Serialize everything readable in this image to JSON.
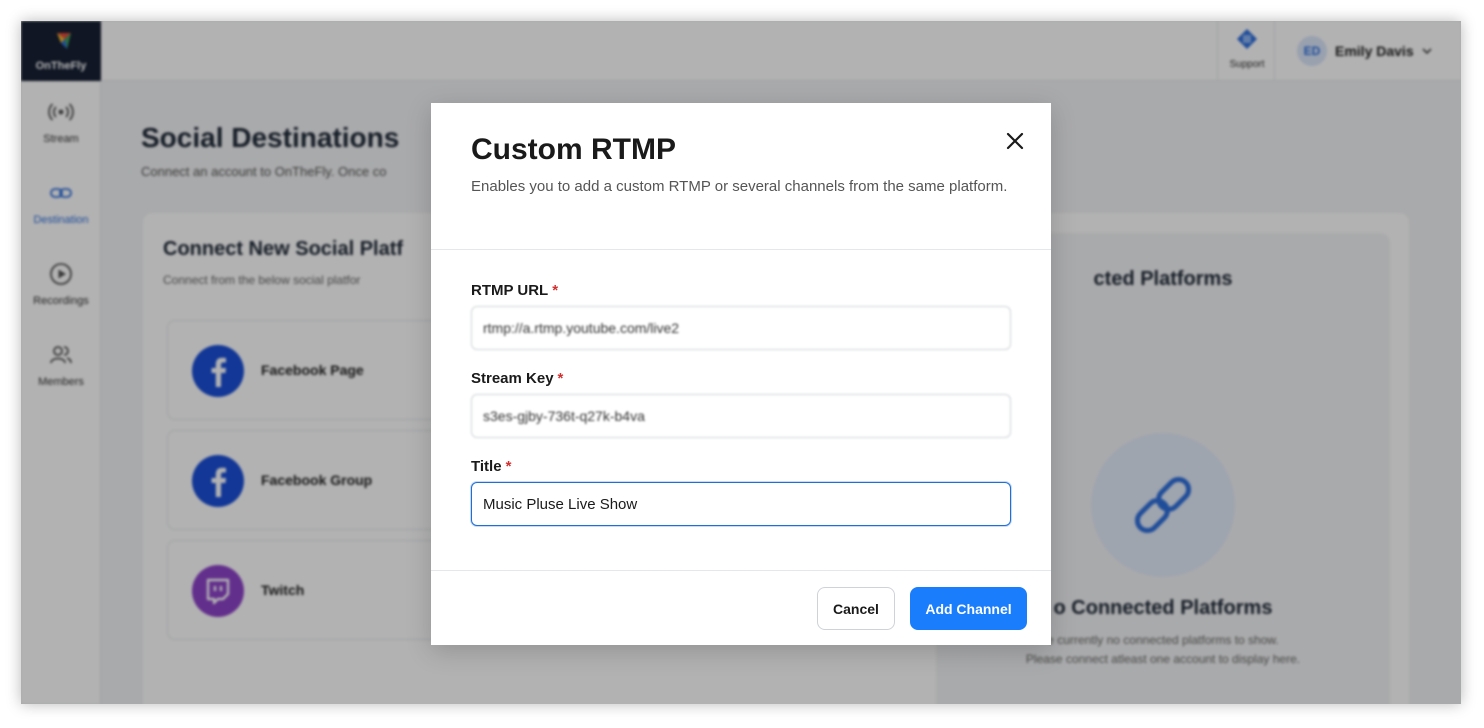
{
  "app": {
    "logo_text": "OnTheFly"
  },
  "header": {
    "support_label": "Support",
    "user": {
      "initials": "ED",
      "name": "Emily Davis"
    }
  },
  "sidebar": {
    "items": [
      {
        "label": "Stream",
        "icon": "broadcast-icon",
        "active": false
      },
      {
        "label": "Destination",
        "icon": "link-icon",
        "active": true
      },
      {
        "label": "Recordings",
        "icon": "play-circle-icon",
        "active": false
      },
      {
        "label": "Members",
        "icon": "users-icon",
        "active": false
      }
    ]
  },
  "page": {
    "title": "Social Destinations",
    "subtitle": "Connect an account to OnTheFly. Once co",
    "connect_panel": {
      "title": "Connect New Social Platf",
      "subtitle": "Connect from the below social platfor",
      "platforms": [
        {
          "name": "Facebook Page",
          "icon": "facebook-icon"
        },
        {
          "name": "Facebook Group",
          "icon": "facebook-icon"
        },
        {
          "name": "Twitch",
          "icon": "twitch-icon"
        }
      ]
    },
    "connected_panel": {
      "title": "cted Platforms",
      "empty_title": "o Connected Platforms",
      "empty_text_line1": "e currently no connected platforms to show.",
      "empty_text_line2": "Please connect atleast one account to display here."
    }
  },
  "modal": {
    "title": "Custom RTMP",
    "description": "Enables you to add a custom RTMP or several channels from the same platform.",
    "fields": {
      "rtmp_url": {
        "label": "RTMP URL",
        "value": "rtmp://a.rtmp.youtube.com/live2"
      },
      "stream_key": {
        "label": "Stream Key",
        "value": "s3es-gjby-736t-q27k-b4va"
      },
      "title": {
        "label": "Title",
        "value": "Music Pluse Live Show"
      }
    },
    "required_marker": "*",
    "cancel_label": "Cancel",
    "submit_label": "Add Channel"
  },
  "colors": {
    "accent": "#1a7dfb",
    "required": "#d32f2f",
    "sidebar_dark": "#172033",
    "facebook": "#1b4fd8",
    "twitch": "#8e44c9"
  }
}
